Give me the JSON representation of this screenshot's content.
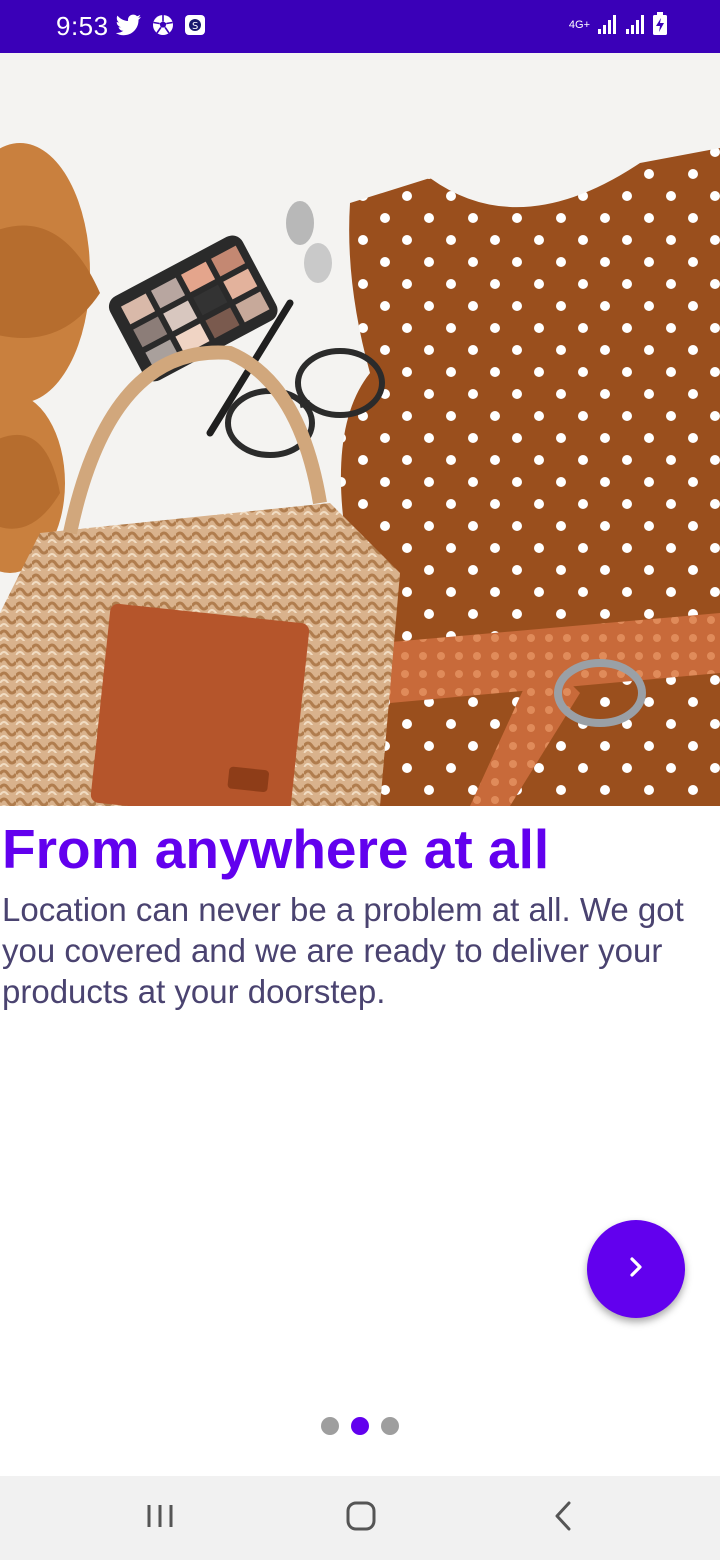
{
  "status_bar": {
    "time": "9:53",
    "network_label": "4G+",
    "left_icons": [
      "twitter-icon",
      "soccer-ball-icon",
      "app-notification-icon"
    ],
    "right_icons": [
      "signal-icon",
      "signal-icon",
      "battery-charging-icon"
    ],
    "background_color": "#3a00b8"
  },
  "onboarding": {
    "title": "From anywhere at all",
    "description": "Location can never be a problem at all. We got you covered and we are ready to deliver your products at your doorstep.",
    "title_color": "#6200ee",
    "description_color": "#4a4370",
    "accent_color": "#6200ee",
    "current_page": 2,
    "total_pages": 3,
    "next_button_icon": "chevron-right-icon"
  },
  "nav_bar": {
    "buttons": [
      "recent-apps-icon",
      "home-icon",
      "back-icon"
    ]
  }
}
